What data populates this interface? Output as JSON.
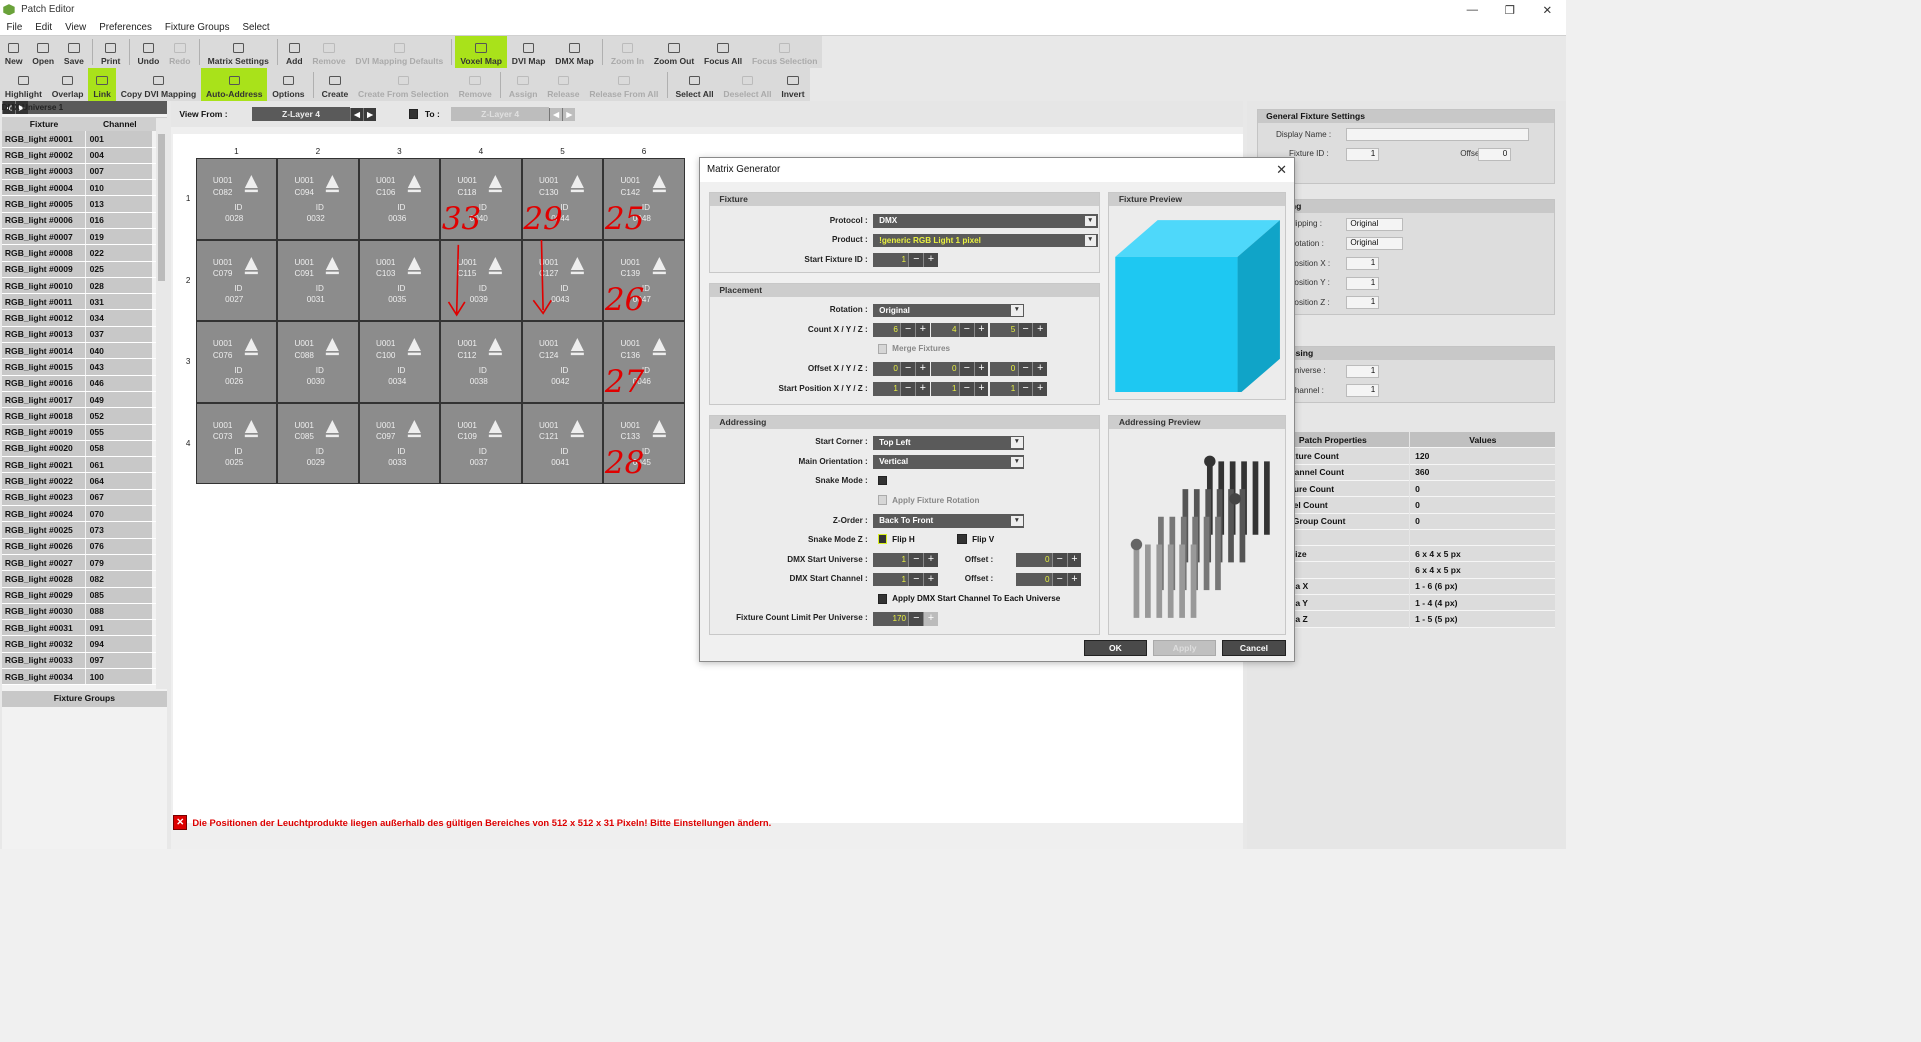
{
  "window": {
    "title": "Patch Editor",
    "min": "—",
    "restore": "❐",
    "close": "✕"
  },
  "menu": [
    "File",
    "Edit",
    "View",
    "Preferences",
    "Fixture Groups",
    "Select"
  ],
  "toolbar1": [
    {
      "label": "New",
      "state": "normal"
    },
    {
      "label": "Open",
      "state": "normal"
    },
    {
      "label": "Save",
      "state": "normal"
    },
    {
      "sep": true
    },
    {
      "label": "Print",
      "state": "normal"
    },
    {
      "sep": true
    },
    {
      "label": "Undo",
      "state": "normal"
    },
    {
      "label": "Redo",
      "state": "disabled"
    },
    {
      "sep": true
    },
    {
      "label": "Matrix Settings",
      "state": "normal"
    },
    {
      "sep": true
    },
    {
      "label": "Add",
      "state": "normal"
    },
    {
      "label": "Remove",
      "state": "disabled"
    },
    {
      "label": "DVI Mapping Defaults",
      "state": "disabled"
    },
    {
      "sep": true
    },
    {
      "label": "Voxel Map",
      "state": "active"
    },
    {
      "label": "DVI Map",
      "state": "normal"
    },
    {
      "label": "DMX Map",
      "state": "normal"
    },
    {
      "sep": true
    },
    {
      "label": "Zoom In",
      "state": "disabled"
    },
    {
      "label": "Zoom Out",
      "state": "normal"
    },
    {
      "label": "Focus All",
      "state": "normal"
    },
    {
      "label": "Focus Selection",
      "state": "disabled"
    }
  ],
  "toolbar2": [
    {
      "label": "Highlight",
      "state": "normal"
    },
    {
      "label": "Overlap",
      "state": "normal"
    },
    {
      "label": "Link",
      "state": "active"
    },
    {
      "label": "Copy DVI Mapping",
      "state": "normal"
    },
    {
      "label": "Auto-Address",
      "state": "active"
    },
    {
      "label": "Options",
      "state": "normal"
    },
    {
      "sep": true
    },
    {
      "label": "Create",
      "state": "normal"
    },
    {
      "label": "Create From Selection",
      "state": "disabled"
    },
    {
      "label": "Remove",
      "state": "disabled"
    },
    {
      "sep": true
    },
    {
      "label": "Assign",
      "state": "disabled"
    },
    {
      "label": "Release",
      "state": "disabled"
    },
    {
      "label": "Release From All",
      "state": "disabled"
    },
    {
      "sep": true
    },
    {
      "label": "Select All",
      "state": "normal"
    },
    {
      "label": "Deselect All",
      "state": "disabled"
    },
    {
      "label": "Invert",
      "state": "normal"
    }
  ],
  "left": {
    "universe": "DMX Universe 1",
    "col_fixture": "Fixture",
    "col_channel": "Channel",
    "rows": [
      [
        "RGB_light #0001",
        "001"
      ],
      [
        "RGB_light #0002",
        "004"
      ],
      [
        "RGB_light #0003",
        "007"
      ],
      [
        "RGB_light #0004",
        "010"
      ],
      [
        "RGB_light #0005",
        "013"
      ],
      [
        "RGB_light #0006",
        "016"
      ],
      [
        "RGB_light #0007",
        "019"
      ],
      [
        "RGB_light #0008",
        "022"
      ],
      [
        "RGB_light #0009",
        "025"
      ],
      [
        "RGB_light #0010",
        "028"
      ],
      [
        "RGB_light #0011",
        "031"
      ],
      [
        "RGB_light #0012",
        "034"
      ],
      [
        "RGB_light #0013",
        "037"
      ],
      [
        "RGB_light #0014",
        "040"
      ],
      [
        "RGB_light #0015",
        "043"
      ],
      [
        "RGB_light #0016",
        "046"
      ],
      [
        "RGB_light #0017",
        "049"
      ],
      [
        "RGB_light #0018",
        "052"
      ],
      [
        "RGB_light #0019",
        "055"
      ],
      [
        "RGB_light #0020",
        "058"
      ],
      [
        "RGB_light #0021",
        "061"
      ],
      [
        "RGB_light #0022",
        "064"
      ],
      [
        "RGB_light #0023",
        "067"
      ],
      [
        "RGB_light #0024",
        "070"
      ],
      [
        "RGB_light #0025",
        "073"
      ],
      [
        "RGB_light #0026",
        "076"
      ],
      [
        "RGB_light #0027",
        "079"
      ],
      [
        "RGB_light #0028",
        "082"
      ],
      [
        "RGB_light #0029",
        "085"
      ],
      [
        "RGB_light #0030",
        "088"
      ],
      [
        "RGB_light #0031",
        "091"
      ],
      [
        "RGB_light #0032",
        "094"
      ],
      [
        "RGB_light #0033",
        "097"
      ],
      [
        "RGB_light #0034",
        "100"
      ]
    ],
    "fixture_groups": "Fixture Groups"
  },
  "view": {
    "from_label": "View From :",
    "from": "Z-Layer 4",
    "to_label": "To :",
    "to": "Z-Layer 4"
  },
  "grid": {
    "cols": [
      "1",
      "2",
      "3",
      "4",
      "5",
      "6"
    ],
    "rows": [
      "1",
      "2",
      "3",
      "4"
    ],
    "cells": [
      [
        [
          "U001",
          "C082",
          "0028"
        ],
        [
          "U001",
          "C094",
          "0032"
        ],
        [
          "U001",
          "C106",
          "0036"
        ],
        [
          "U001",
          "C118",
          "0040"
        ],
        [
          "U001",
          "C130",
          "0044"
        ],
        [
          "U001",
          "C142",
          "0048"
        ]
      ],
      [
        [
          "U001",
          "C079",
          "0027"
        ],
        [
          "U001",
          "C091",
          "0031"
        ],
        [
          "U001",
          "C103",
          "0035"
        ],
        [
          "U001",
          "C115",
          "0039"
        ],
        [
          "U001",
          "C127",
          "0043"
        ],
        [
          "U001",
          "C139",
          "0047"
        ]
      ],
      [
        [
          "U001",
          "C076",
          "0026"
        ],
        [
          "U001",
          "C088",
          "0030"
        ],
        [
          "U001",
          "C100",
          "0034"
        ],
        [
          "U001",
          "C112",
          "0038"
        ],
        [
          "U001",
          "C124",
          "0042"
        ],
        [
          "U001",
          "C136",
          "0046"
        ]
      ],
      [
        [
          "U001",
          "C073",
          "0025"
        ],
        [
          "U001",
          "C085",
          "0029"
        ],
        [
          "U001",
          "C097",
          "0033"
        ],
        [
          "U001",
          "C109",
          "0037"
        ],
        [
          "U001",
          "C121",
          "0041"
        ],
        [
          "U001",
          "C133",
          "0045"
        ]
      ]
    ],
    "id_label": "ID",
    "annotations": [
      "33",
      "29",
      "25",
      "26",
      "27",
      "28"
    ]
  },
  "error": "Die Positionen der Leuchtprodukte liegen außerhalb des gültigen Bereiches von 512 x 512 x 31 Pixeln! Bitte Einstellungen ändern.",
  "right": {
    "general": "General Fixture Settings",
    "display_name": "Display Name :",
    "fixture_id": "Fixture ID :",
    "fixture_id_val": "1",
    "offset": "Offset :",
    "offset_val": "0",
    "mapping": "Mapping",
    "flipping": "Flipping :",
    "rotation": "Rotation :",
    "original": "Original",
    "pos_x": "Position X :",
    "pos_y": "Position Y :",
    "pos_z": "Position Z :",
    "one": "1",
    "addressing": "Addressing",
    "universe": "Universe :",
    "channel": "Channel :",
    "props_h": "Patch Properties",
    "vals_h": "Values",
    "props": [
      [
        "DMX Fixture Count",
        "120"
      ],
      [
        "DMX Channel Count",
        "360"
      ],
      [
        "DVI Fixture Count",
        "0"
      ],
      [
        "DVI Voxel Count",
        "0"
      ],
      [
        "Fixture Group Count",
        "0"
      ],
      [
        "",
        ""
      ],
      [
        "Space Size",
        "6 x 4 x 5 px"
      ],
      [
        "Size",
        "6 x 4 x 5 px"
      ],
      [
        "Map Area X",
        "1 - 6 (6 px)"
      ],
      [
        "Map Area Y",
        "1 - 4 (4 px)"
      ],
      [
        "Map Area Z",
        "1 - 5 (5 px)"
      ]
    ]
  },
  "dialog": {
    "title": "Matrix Generator",
    "fixture_h": "Fixture",
    "protocol_l": "Protocol :",
    "protocol": "DMX",
    "product_l": "Product :",
    "product": "!generic RGB Light 1 pixel",
    "start_id_l": "Start Fixture ID :",
    "start_id": "1",
    "preview_h": "Fixture Preview",
    "placement_h": "Placement",
    "rotation_l": "Rotation :",
    "rotation": "Original",
    "count_l": "Count X / Y / Z :",
    "count": [
      "6",
      "4",
      "5"
    ],
    "merge": "Merge Fixtures",
    "offset_l": "Offset X / Y / Z :",
    "offset": [
      "0",
      "0",
      "0"
    ],
    "startpos_l": "Start Position X / Y / Z :",
    "startpos": [
      "1",
      "1",
      "1"
    ],
    "addressing_h": "Addressing",
    "corner_l": "Start Corner :",
    "corner": "Top Left",
    "orient_l": "Main Orientation :",
    "orient": "Vertical",
    "snake_l": "Snake Mode :",
    "apply_rot": "Apply Fixture Rotation",
    "zorder_l": "Z-Order :",
    "zorder": "Back To Front",
    "snakez_l": "Snake Mode Z :",
    "fliph": "Flip H",
    "flipv": "Flip V",
    "dmxuni_l": "DMX Start Universe :",
    "dmxuni": "1",
    "dmxch_l": "DMX Start Channel :",
    "dmxch": "1",
    "off_l": "Offset :",
    "off_val": "0",
    "apply_dmx": "Apply DMX Start Channel To Each Universe",
    "limit_l": "Fixture Count Limit Per Universe :",
    "limit": "170",
    "addr_preview_h": "Addressing Preview",
    "ok": "OK",
    "apply": "Apply",
    "cancel": "Cancel"
  },
  "colors": {
    "accent": "#a9e21a",
    "cube_front": "#1ec8f2",
    "cube_top": "#4ed8fa",
    "cube_side": "#10a4c8",
    "error": "#dd0000",
    "annotation": "#e00000"
  }
}
